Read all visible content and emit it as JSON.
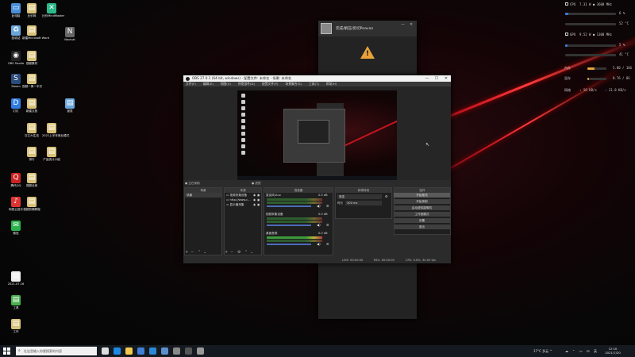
{
  "desktop": {
    "icons": [
      {
        "label": "此电脑",
        "glyph": "▭",
        "color": "#4a90d9"
      },
      {
        "label": "比价网",
        "glyph": "▤",
        "color": "#d8c27a"
      },
      {
        "label": "比价MindMaster",
        "glyph": "✕",
        "color": "#2db88a"
      },
      {
        "label": "回收站",
        "glyph": "♻",
        "color": "#6aa7d8"
      },
      {
        "label": "新建Microsoft Word",
        "glyph": "▤",
        "color": "#d8c27a"
      },
      {
        "label": "Navicat",
        "glyph": "N",
        "color": "#666"
      },
      {
        "label": "OBS Studio",
        "glyph": "◉",
        "color": "#222"
      },
      {
        "label": "视频素材",
        "glyph": "▤",
        "color": "#d8c27a"
      },
      {
        "label": "Steam",
        "glyph": "S",
        "color": "#2a4b7c"
      },
      {
        "label": "视频一周一半次",
        "glyph": "▤",
        "color": "#d8c27a"
      },
      {
        "label": "钉钉",
        "glyph": "D",
        "color": "#2f7de1"
      },
      {
        "label": "新建文档",
        "glyph": "▤",
        "color": "#d8c27a"
      },
      {
        "label": "报表",
        "glyph": "▤",
        "color": "#6aa7d8"
      },
      {
        "label": "汉江AI生态",
        "glyph": "▤",
        "color": "#d8c27a"
      },
      {
        "label": "2021上半年商业模式",
        "glyph": "▤",
        "color": "#d8c27a"
      },
      {
        "label": "排行",
        "glyph": "▤",
        "color": "#d8c27a"
      },
      {
        "label": "产品统计小组",
        "glyph": "▤",
        "color": "#d8c27a"
      },
      {
        "label": "腾讯QQ",
        "glyph": "Q",
        "color": "#c22"
      },
      {
        "label": "视频仓库",
        "glyph": "▤",
        "color": "#d8c27a"
      },
      {
        "label": "网易云音乐",
        "glyph": "♪",
        "color": "#d33"
      },
      {
        "label": "视频剪辑教程",
        "glyph": "▤",
        "color": "#d8c27a"
      },
      {
        "label": "微信",
        "glyph": "✉",
        "color": "#2bb24c"
      },
      {
        "label": "2021.07.16",
        "glyph": "▤",
        "color": "#eee"
      },
      {
        "label": "工具",
        "glyph": "▤",
        "color": "#4caf50"
      },
      {
        "label": "工作",
        "glyph": "▤",
        "color": "#d8c27a"
      }
    ]
  },
  "hwmonitor": {
    "cpu_label": "CPU",
    "cpu_info": "7.31 W  ● 3600 MHz",
    "cpu_load": "6 %",
    "cpu_temp": "52 °C",
    "cpu_load_pct": 0.06,
    "gpu_label": "GPU",
    "gpu_info": "9.52 W  ● 1300 MHz",
    "gpu_load": "5 %",
    "gpu_temp": "41 °C",
    "gpu_load_pct": 0.05,
    "mem1_label": "內存",
    "mem1_value": "5.80 / 16G",
    "mem1_pct": 0.36,
    "mem2_label": "显存",
    "mem2_value": "0.76 / 8G",
    "mem2_pct": 0.1,
    "net_label": "网络",
    "net_up": "56 KB/s",
    "net_down": "21.8 KB/s",
    "accent": "#e8a13c",
    "blue": "#3a7bd5"
  },
  "popup": {
    "title": "完成/解压/剪切Peavan",
    "warning_title": "封禁/暂停/隐私/运行问题",
    "warning_detail": "运行期间暂停运行权限请问您需要临时解决这一问题",
    "btn_min": "—",
    "btn_close": "✕"
  },
  "obs": {
    "title": "OBS 27.0.1 (64-bit, windows) - 配置文件: 未命名 - 场景: 未命名",
    "menu": [
      "文件(F)",
      "编辑(E)",
      "视图(V)",
      "停靠部件(D)",
      "配置文件(P)",
      "场景集合(S)",
      "工具(T)",
      "帮助(H)"
    ],
    "btn_min": "—",
    "btn_max": "☐",
    "btn_close": "✕",
    "dock_source_label": "● 正在录制",
    "dock_filter_label": "● 滤镜",
    "scenes_header": "场景",
    "scenes": [
      "场景"
    ],
    "sources_header": "来源",
    "sources": [
      "视频采集设备",
      "http://www.c...",
      "显示器采集"
    ],
    "mixer_header": "混音器",
    "mixer": [
      {
        "name": "麦克风/Aux",
        "level": "0.0 dB"
      },
      {
        "name": "视频采集设备",
        "level": "0.0 dB"
      },
      {
        "name": "桌面音频",
        "level": "0.0 dB"
      }
    ],
    "transitions_header": "转场特效",
    "transition_value": "渐变",
    "duration_label": "时长",
    "duration_value": "300 ms",
    "controls_header": "控件",
    "controls": [
      "开始推流",
      "开始录制",
      "启动虚拟摄像机",
      "工作室模式",
      "设置",
      "退出"
    ],
    "status": {
      "live": "LIVE: 00:00:00",
      "rec": "REC: 00:00:00",
      "cpu": "CPU: 0.6%, 30.00 fps"
    }
  },
  "taskbar": {
    "search_placeholder": "在这里输入你要搜索的内容",
    "weather": "17°C 多云 ^",
    "tray_icons": [
      "☁",
      "⌃",
      "▭",
      "☊",
      "英"
    ],
    "time": "12:10",
    "date": "2021/7/20",
    "pinned": [
      {
        "name": "task-view-icon",
        "color": "#ddd"
      },
      {
        "name": "edge-icon",
        "color": "#1e88e5"
      },
      {
        "name": "explorer-icon",
        "color": "#f2c94c"
      },
      {
        "name": "store-icon",
        "color": "#3f7fd8"
      },
      {
        "name": "mail-icon",
        "color": "#2b88d8"
      },
      {
        "name": "steam-icon",
        "color": "#5b8fd0"
      },
      {
        "name": "app-icon",
        "color": "#888"
      },
      {
        "name": "obs-icon",
        "color": "#555"
      },
      {
        "name": "app2-icon",
        "color": "#999"
      }
    ]
  }
}
